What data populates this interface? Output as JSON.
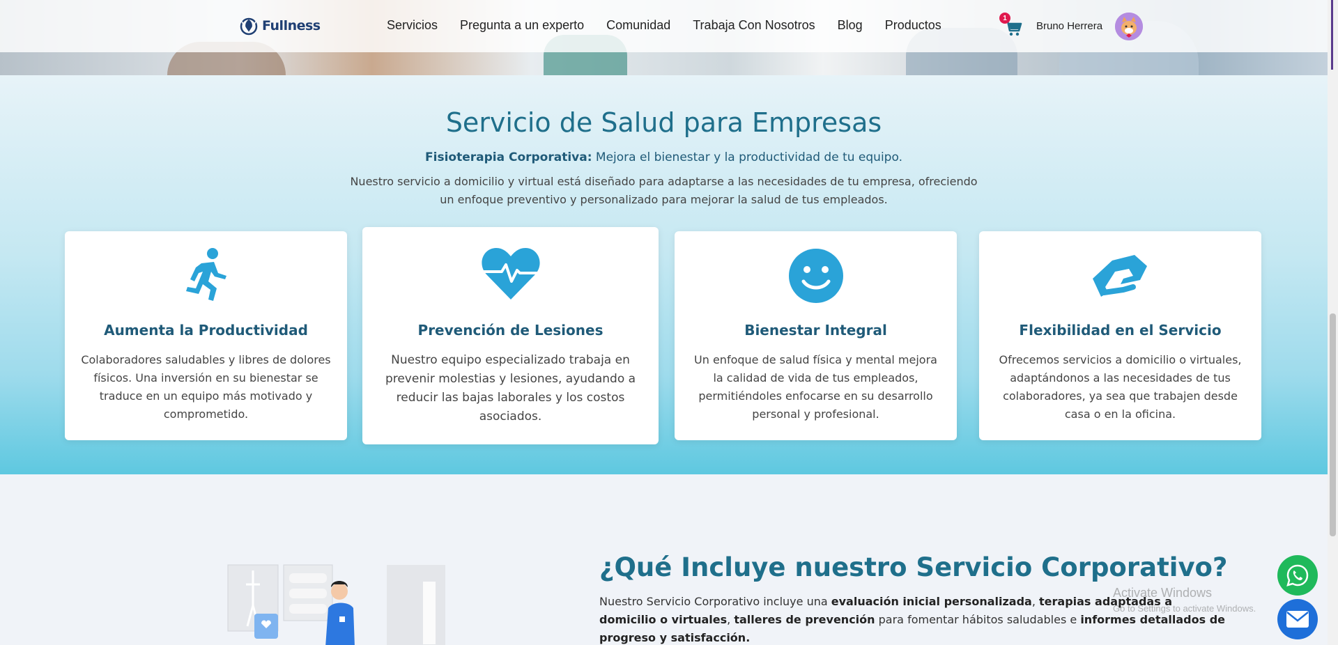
{
  "brand": {
    "name": "Fullness"
  },
  "nav": {
    "items": [
      "Servicios",
      "Pregunta a un experto",
      "Comunidad",
      "Trabaja Con Nosotros",
      "Blog",
      "Productos"
    ],
    "cart_count": "1",
    "user_name": "Bruno Herrera"
  },
  "service": {
    "title": "Servicio de Salud para Empresas",
    "subtitle_bold": "Fisioterapia Corporativa:",
    "subtitle_rest": " Mejora el bienestar y la productividad de tu equipo.",
    "description": "Nuestro servicio a domicilio y virtual está diseñado para adaptarse a las necesidades de tu empresa, ofreciendo un enfoque preventivo y personalizado para mejorar la salud de tus empleados.",
    "cards": [
      {
        "icon": "running-person-icon",
        "title": "Aumenta la Productividad",
        "text": "Colaboradores saludables y libres de dolores físicos. Una inversión en su bienestar se traduce en un equipo más motivado y comprometido."
      },
      {
        "icon": "heart-pulse-icon",
        "title": "Prevención de Lesiones",
        "text": "Nuestro equipo especializado trabaja en prevenir molestias y lesiones, ayudando a reducir las bajas laborales y los costos asociados."
      },
      {
        "icon": "smile-icon",
        "title": "Bienestar Integral",
        "text": "Un enfoque de salud física y mental mejora la calidad de vida de tus empleados, permitiéndoles enfocarse en su desarrollo personal y profesional."
      },
      {
        "icon": "handshake-icon",
        "title": "Flexibilidad en el Servicio",
        "text": "Ofrecemos servicios a domicilio o virtuales, adaptándonos a las necesidades de tus colaboradores, ya sea que trabajen desde casa o en la oficina."
      }
    ]
  },
  "corporate": {
    "title": "¿Qué Incluye nuestro Servicio Corporativo?",
    "text_parts": [
      "Nuestro Servicio Corporativo incluye una ",
      "evaluación inicial personalizada",
      ", ",
      "terapias adaptadas a domicilio o virtuales",
      ", ",
      "talleres de prevención",
      " para fomentar hábitos saludables e ",
      "informes detallados de progreso y satisfacción."
    ]
  },
  "watermark": {
    "line1": "Activate Windows",
    "line2": "Go to Settings to activate Windows."
  },
  "colors": {
    "accent": "#1f6f8b",
    "icon_blue": "#2aa3d8",
    "badge": "#e0194e",
    "whatsapp": "#1fb95b",
    "mail": "#1e6fd9"
  }
}
